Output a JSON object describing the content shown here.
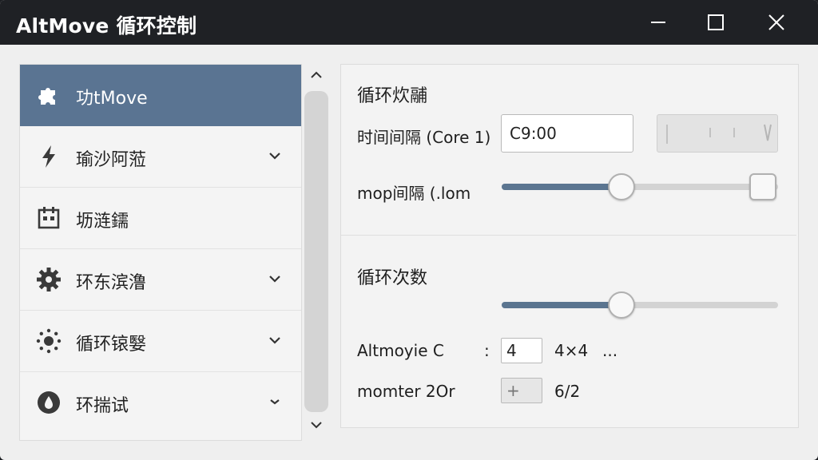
{
  "window": {
    "title": "AltMove 循环控制"
  },
  "titlebar_buttons": {
    "minimize_icon": "minimize-icon",
    "maximize_icon": "maximize-icon",
    "close_icon": "close-icon"
  },
  "sidebar": {
    "items": [
      {
        "label": "功tMove",
        "icon": "puzzle-gear-icon",
        "active": true,
        "has_chevron": false
      },
      {
        "label": "瑜沙阿蒞",
        "icon": "lightning-icon",
        "active": false,
        "has_chevron": true
      },
      {
        "label": "坜涟鑐",
        "icon": "calendar-icon",
        "active": false,
        "has_chevron": false
      },
      {
        "label": "环东滨澛",
        "icon": "gear-icon",
        "active": false,
        "has_chevron": true
      },
      {
        "label": "循环锿嫛",
        "icon": "settings-dots-icon",
        "active": false,
        "has_chevron": true
      },
      {
        "label": "环揣试",
        "icon": "drop-icon",
        "active": false,
        "has_chevron": true
      }
    ]
  },
  "panel": {
    "interval_section": {
      "title": "循环炊鬴",
      "time_label": "时间间隔 (Core 1)",
      "time_value": "C9:00",
      "mop_label": "mop间隔 (.lom"
    },
    "count_section": {
      "title": "循环次数",
      "slider_level": 0.3,
      "row1_label": "Altmoyie C",
      "row1_colon": ":",
      "row1_value": "4",
      "row1_extra": "4×4",
      "row1_ellipsis": "...",
      "row2_label": "momter 2Or",
      "row2_value": "+",
      "row2_extra": "6/2"
    }
  },
  "colors": {
    "accent": "#5a7492",
    "titlebar": "#1f2125",
    "background": "#efefef"
  }
}
